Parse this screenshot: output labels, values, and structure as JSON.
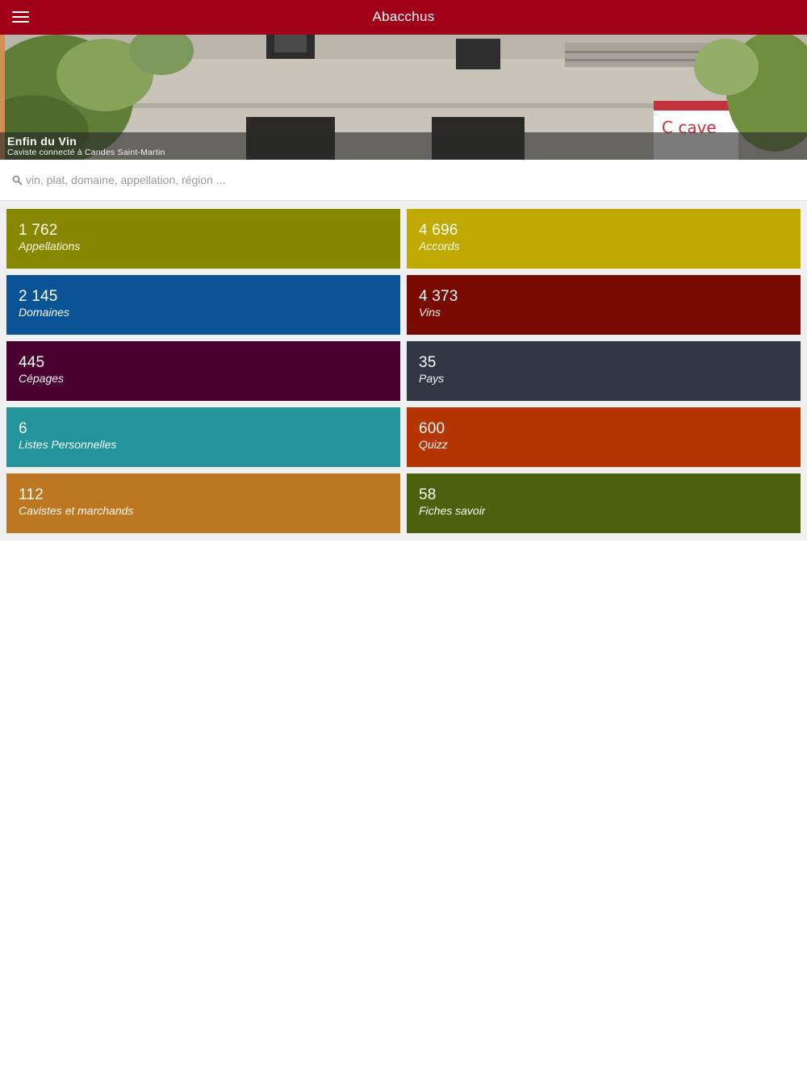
{
  "header": {
    "title": "Abacchus"
  },
  "hero": {
    "name": "Enfin du Vin",
    "subtitle": "Caviste connecté à Candes Saint-Martin"
  },
  "search": {
    "placeholder": "vin, plat, domaine, appellation, région ..."
  },
  "tiles": [
    {
      "count": "1 762",
      "label": "Appellations",
      "color": "#878700"
    },
    {
      "count": "4 696",
      "label": "Accords",
      "color": "#c0a900"
    },
    {
      "count": "2 145",
      "label": "Domaines",
      "color": "#0a5495"
    },
    {
      "count": "4 373",
      "label": "Vins",
      "color": "#790a01"
    },
    {
      "count": "445",
      "label": "Cépages",
      "color": "#4a0030"
    },
    {
      "count": "35",
      "label": "Pays",
      "color": "#303644"
    },
    {
      "count": "6",
      "label": "Listes Personnelles",
      "color": "#23949b"
    },
    {
      "count": "600",
      "label": "Quizz",
      "color": "#b53504"
    },
    {
      "count": "112",
      "label": "Cavistes et marchands",
      "color": "#be7721"
    },
    {
      "count": "58",
      "label": "Fiches savoir",
      "color": "#4c610e"
    }
  ],
  "colors": {
    "brand": "#a00018",
    "page_bg": "#f0f0f0"
  }
}
